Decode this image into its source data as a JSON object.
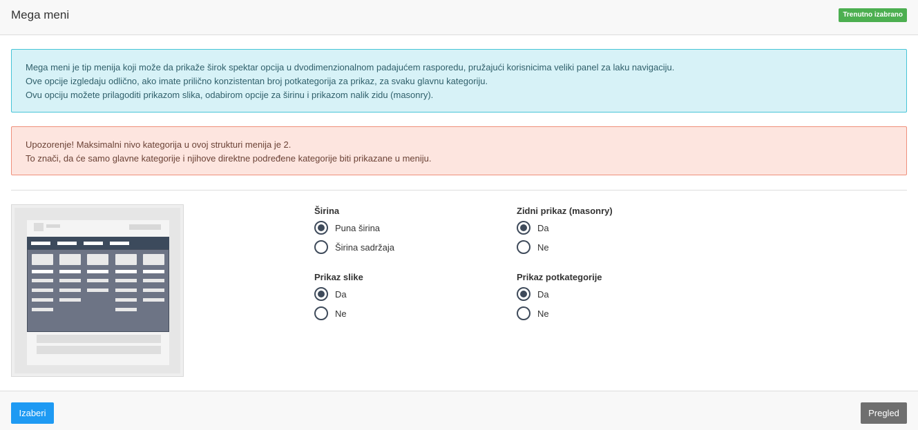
{
  "header": {
    "title": "Mega meni",
    "badge": "Trenutno izabrano"
  },
  "info_alert": {
    "lines": [
      "Mega meni je tip menija koji može da prikaže širok spektar opcija u dvodimenzionalnom padajućem rasporedu, pružajući korisnicima veliki panel za laku navigaciju.",
      "Ove opcije izgledaju odlično, ako imate prilično konzistentan broj potkategorija za prikaz, za svaku glavnu kategoriju.",
      "Ovu opciju možete prilagoditi prikazom slika, odabirom opcije za širinu i prikazom nalik zidu (masonry)."
    ]
  },
  "warning_alert": {
    "lines": [
      "Upozorenje! Maksimalni nivo kategorija u ovoj strukturi menija je 2.",
      "To znači, da će samo glavne kategorije i njihove direktne podređene kategorije biti prikazane u meniju."
    ]
  },
  "options": {
    "width": {
      "title": "Širina",
      "choices": [
        {
          "label": "Puna širina",
          "checked": true
        },
        {
          "label": "Širina sadržaja",
          "checked": false
        }
      ]
    },
    "masonry": {
      "title": "Zidni prikaz (masonry)",
      "choices": [
        {
          "label": "Da",
          "checked": true
        },
        {
          "label": "Ne",
          "checked": false
        }
      ]
    },
    "image": {
      "title": "Prikaz slike",
      "choices": [
        {
          "label": "Da",
          "checked": true
        },
        {
          "label": "Ne",
          "checked": false
        }
      ]
    },
    "subcategory": {
      "title": "Prikaz potkategorije",
      "choices": [
        {
          "label": "Da",
          "checked": true
        },
        {
          "label": "Ne",
          "checked": false
        }
      ]
    }
  },
  "footer": {
    "select_label": "Izaberi",
    "preview_label": "Pregled"
  },
  "colors": {
    "primary": "#1e9af3",
    "badge": "#4caf50",
    "info_bg": "#d7f2f7",
    "warning_bg": "#fde5df",
    "radio": "#3e4a5a"
  }
}
